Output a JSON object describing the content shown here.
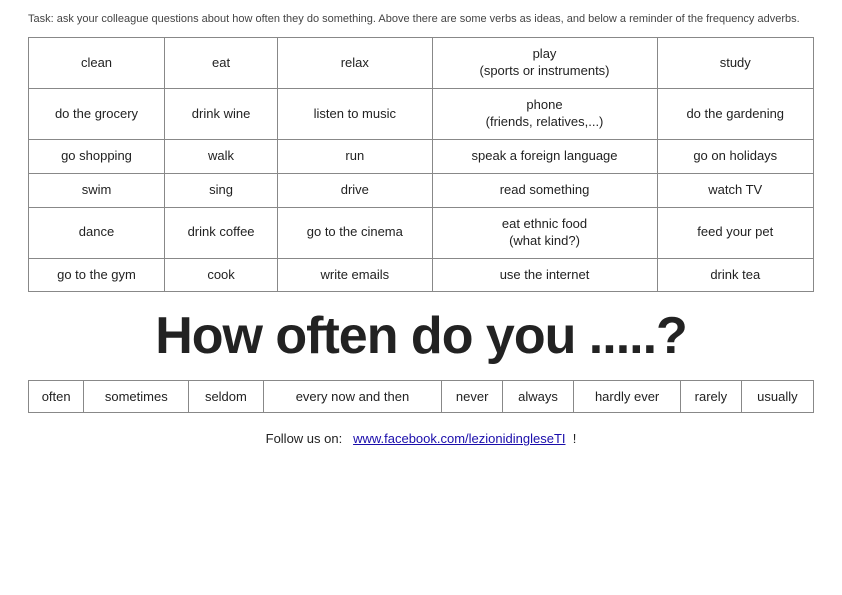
{
  "task": {
    "text": "Task: ask your colleague questions about how often they do something. Above there are some verbs as ideas, and below a reminder of the frequency adverbs."
  },
  "verbs_table": {
    "rows": [
      [
        "clean",
        "eat",
        "relax",
        "play\n(sports or instruments)",
        "study"
      ],
      [
        "do the grocery",
        "drink wine",
        "listen to music",
        "phone\n(friends, relatives,...)",
        "do the gardening"
      ],
      [
        "go shopping",
        "walk",
        "run",
        "speak a foreign language",
        "go on holidays"
      ],
      [
        "swim",
        "sing",
        "drive",
        "read something",
        "watch TV"
      ],
      [
        "dance",
        "drink coffee",
        "go to the cinema",
        "eat ethnic food\n(what kind?)",
        "feed your pet"
      ],
      [
        "go to the gym",
        "cook",
        "write emails",
        "use the internet",
        "drink tea"
      ]
    ]
  },
  "big_question": "How often do you .....?",
  "frequency_adverbs": [
    "often",
    "sometimes",
    "seldom",
    "every now and then",
    "never",
    "always",
    "hardly ever",
    "rarely",
    "usually"
  ],
  "follow": {
    "label": "Follow us on:",
    "link_text": "www.facebook.com/lezionidingleseTI",
    "link_href": "#",
    "suffix": "!"
  }
}
